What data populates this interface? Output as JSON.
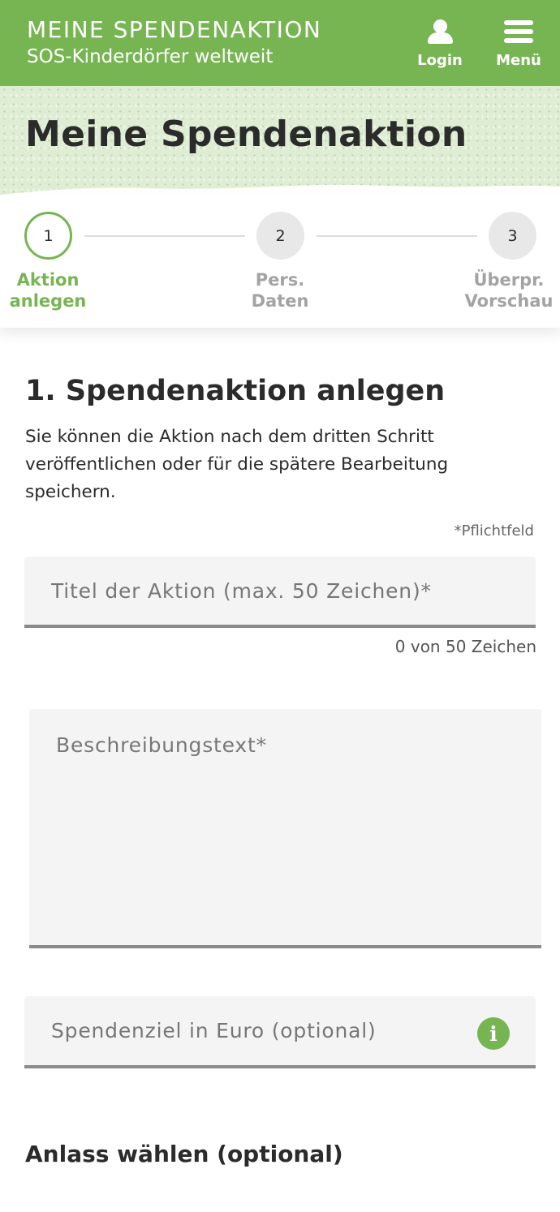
{
  "header": {
    "brand_title": "MEINE SPENDENAKTION",
    "brand_subtitle": "SOS-Kinderdörfer weltweit",
    "login_label": "Login",
    "menu_label": "Menü",
    "login_icon": "user-icon",
    "menu_icon": "hamburger-menu-icon",
    "color": "#77b553"
  },
  "hero": {
    "title": "Meine Spendenaktion"
  },
  "stepper": {
    "steps": [
      {
        "number": "1",
        "label_line1": "Aktion",
        "label_line2": "anlegen",
        "state": "active"
      },
      {
        "number": "2",
        "label_line1": "Pers.",
        "label_line2": "Daten",
        "state": "inactive"
      },
      {
        "number": "3",
        "label_line1": "Überpr.",
        "label_line2": "Vorschau",
        "state": "inactive"
      }
    ]
  },
  "main": {
    "section_title": "1. Spendenaktion anlegen",
    "intro_text": "Sie können die Aktion nach dem dritten Schritt veröffentlichen oder für die spätere Bearbeitung speichern.",
    "required_note": "*Pflichtfeld",
    "title_field": {
      "placeholder": "Titel der Aktion (max. 50 Zeichen)*",
      "value": "",
      "char_count": "0 von 50 Zeichen"
    },
    "description_field": {
      "placeholder": "Beschreibungstext*",
      "value": ""
    },
    "goal_field": {
      "placeholder": "Spendenziel in Euro (optional)",
      "value": "",
      "info_icon": "info-icon"
    },
    "occasion_title": "Anlass wählen (optional)"
  }
}
